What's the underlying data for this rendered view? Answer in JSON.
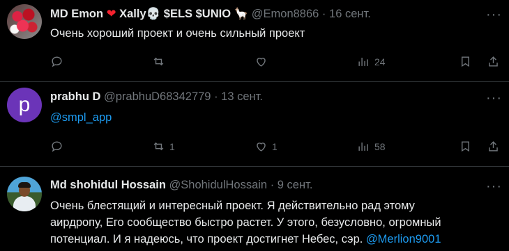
{
  "tweets": [
    {
      "name": "MD Emon",
      "name_suffix": "Xally💀 $ELS $UNIO 🦙",
      "handle": "@Emon8866",
      "date": "16 сент.",
      "text": "Очень хороший проект и очень сильный проект",
      "replies": "",
      "retweets": "",
      "likes": "",
      "views": "24"
    },
    {
      "name": "prabhu D",
      "avatar_letter": "p",
      "handle": "@prabhuD68342779",
      "date": "13 сент.",
      "text": "@smpl_app",
      "replies": "",
      "retweets": "1",
      "likes": "1",
      "views": "58"
    },
    {
      "name": "Md shohidul Hossain",
      "handle": "@ShohidulHossain",
      "date": "9 сент.",
      "text_lines": [
        "Очень блестящий и интересный проект. Я действительно рад этому",
        "аирдропу, Его сообщество быстро растет. У этого, безусловно, огромный",
        "потенциал. И я надеюсь, что проект достигнет Небес, сэр. "
      ],
      "mention": "@Merlion9001"
    }
  ],
  "ui": {
    "more_label": "···",
    "separator": "·"
  },
  "colors": {
    "background": "#000000",
    "text": "#e7e9ea",
    "muted": "#71767b",
    "link": "#1d9bf0",
    "divider": "#2f3336"
  }
}
